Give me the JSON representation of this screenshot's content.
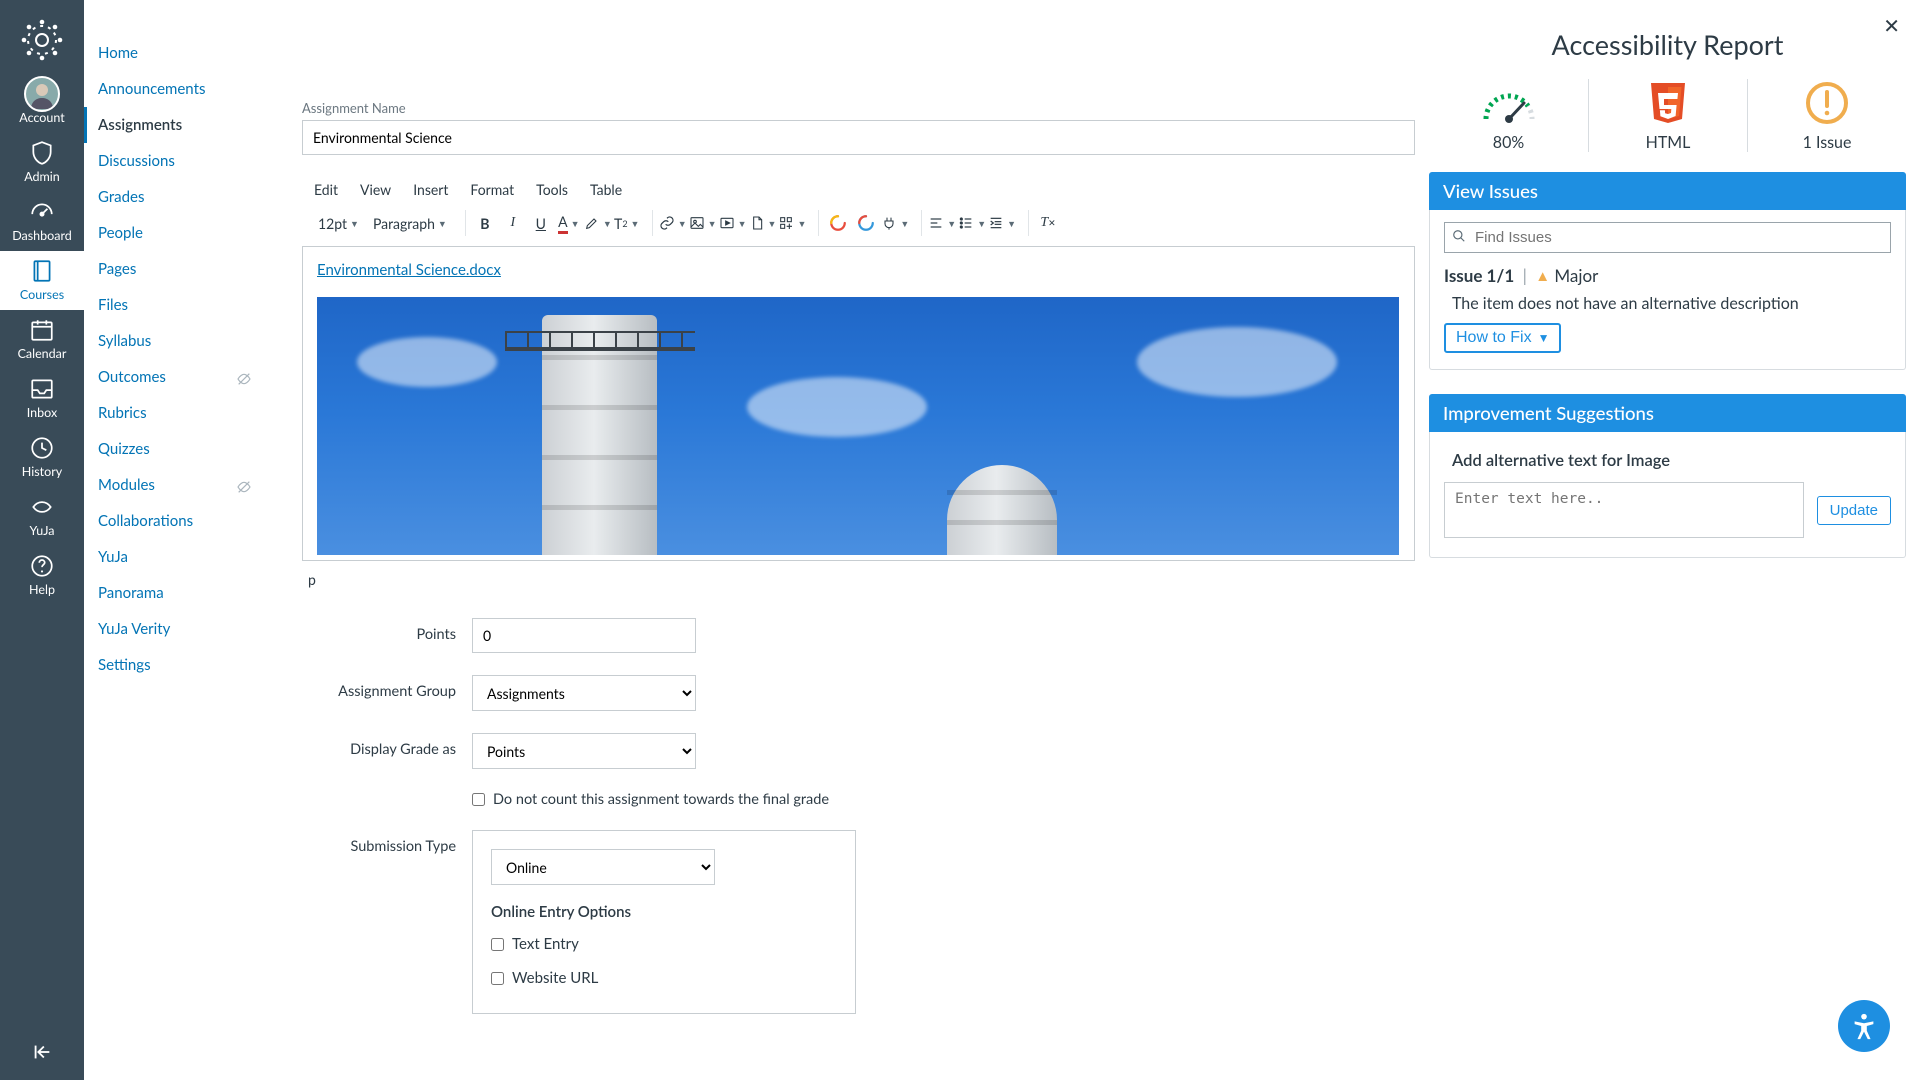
{
  "global_nav": {
    "items": [
      {
        "id": "account",
        "label": "Account"
      },
      {
        "id": "admin",
        "label": "Admin"
      },
      {
        "id": "dashboard",
        "label": "Dashboard"
      },
      {
        "id": "courses",
        "label": "Courses"
      },
      {
        "id": "calendar",
        "label": "Calendar"
      },
      {
        "id": "inbox",
        "label": "Inbox"
      },
      {
        "id": "history",
        "label": "History"
      },
      {
        "id": "yuja",
        "label": "YuJa"
      },
      {
        "id": "help",
        "label": "Help"
      }
    ],
    "active": "courses"
  },
  "course_nav": {
    "items": [
      {
        "label": "Home"
      },
      {
        "label": "Announcements"
      },
      {
        "label": "Assignments",
        "active": true
      },
      {
        "label": "Discussions"
      },
      {
        "label": "Grades"
      },
      {
        "label": "People"
      },
      {
        "label": "Pages"
      },
      {
        "label": "Files"
      },
      {
        "label": "Syllabus"
      },
      {
        "label": "Outcomes",
        "hidden_icon": true
      },
      {
        "label": "Rubrics"
      },
      {
        "label": "Quizzes"
      },
      {
        "label": "Modules",
        "hidden_icon": true
      },
      {
        "label": "Collaborations"
      },
      {
        "label": "YuJa"
      },
      {
        "label": "Panorama"
      },
      {
        "label": "YuJa Verity"
      },
      {
        "label": "Settings"
      }
    ]
  },
  "assignment": {
    "name_label": "Assignment Name",
    "name_value": "Environmental Science",
    "doc_link": "Environmental Science.docx",
    "status_path": "p",
    "points_label": "Points",
    "points_value": "0",
    "group_label": "Assignment Group",
    "group_value": "Assignments",
    "display_label": "Display Grade as",
    "display_value": "Points",
    "nocount_label": "Do not count this assignment towards the final grade",
    "submission_label": "Submission Type",
    "submission_value": "Online",
    "entry_header": "Online Entry Options",
    "entry_options": [
      "Text Entry",
      "Website URL"
    ]
  },
  "editor": {
    "menus": [
      "Edit",
      "View",
      "Insert",
      "Format",
      "Tools",
      "Table"
    ],
    "font_size": "12pt",
    "block_style": "Paragraph"
  },
  "a11y": {
    "title": "Accessibility Report",
    "score_pct": "80%",
    "format_label": "HTML",
    "issue_count_label": "1 Issue",
    "view_issues_hdr": "View Issues",
    "search_placeholder": "Find Issues",
    "issue_counter": "Issue 1/1",
    "severity": "Major",
    "issue_desc": "The item does not have an alternative description",
    "how_to_fix": "How to Fix",
    "suggestions_hdr": "Improvement Suggestions",
    "suggestion_title": "Add alternative text for Image",
    "alt_placeholder": "Enter text here..",
    "update_btn": "Update"
  },
  "colors": {
    "primary_blue": "#1e8fe1",
    "link_blue": "#0374b5",
    "warn_amber": "#f0ad4e",
    "html5_orange": "#e44d26",
    "gauge_green": "#00a651"
  }
}
